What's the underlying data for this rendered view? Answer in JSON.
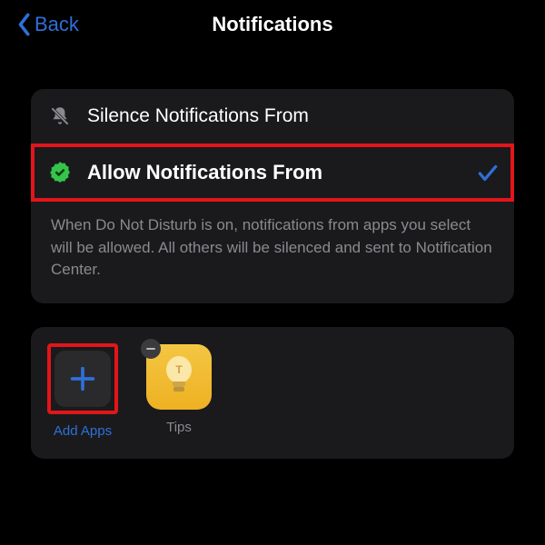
{
  "header": {
    "back_label": "Back",
    "title": "Notifications"
  },
  "options": {
    "silence": {
      "label": "Silence Notifications From"
    },
    "allow": {
      "label": "Allow Notifications From",
      "selected": true
    }
  },
  "description": "When Do Not Disturb is on, notifications from apps you select will be allowed. All others will be silenced and sent to Notification Center.",
  "apps": {
    "add_label": "Add Apps",
    "tips_label": "Tips"
  },
  "colors": {
    "accent": "#2f6fd8",
    "highlight_border": "#e2151a",
    "verified_badge": "#36c44b",
    "tips_bg": "#f0bb32"
  }
}
